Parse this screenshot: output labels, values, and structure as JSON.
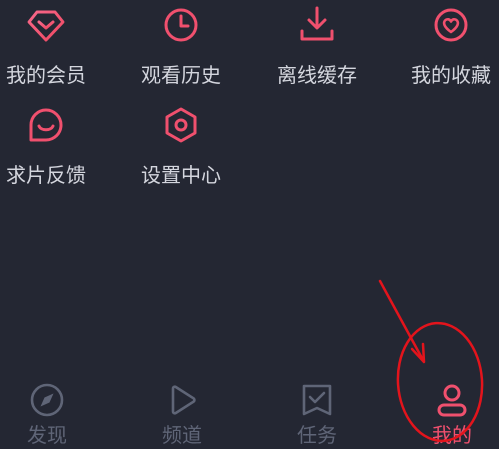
{
  "menu": {
    "items": [
      {
        "label": "我的会员",
        "icon": "diamond-icon"
      },
      {
        "label": "观看历史",
        "icon": "clock-icon"
      },
      {
        "label": "离线缓存",
        "icon": "download-icon"
      },
      {
        "label": "我的收藏",
        "icon": "heart-icon"
      },
      {
        "label": "求片反馈",
        "icon": "feedback-smile-icon"
      },
      {
        "label": "设置中心",
        "icon": "settings-hexagon-icon"
      }
    ]
  },
  "tabbar": {
    "tabs": [
      {
        "label": "发现",
        "icon": "compass-icon",
        "active": false
      },
      {
        "label": "频道",
        "icon": "play-icon",
        "active": false
      },
      {
        "label": "任务",
        "icon": "task-check-icon",
        "active": false
      },
      {
        "label": "我的",
        "icon": "user-icon",
        "active": true
      }
    ]
  },
  "colors": {
    "background": "#242733",
    "accent": "#f0506e",
    "inactive_tab": "#5f6577",
    "label": "#d4d6de",
    "annotation": "#e3141c"
  }
}
